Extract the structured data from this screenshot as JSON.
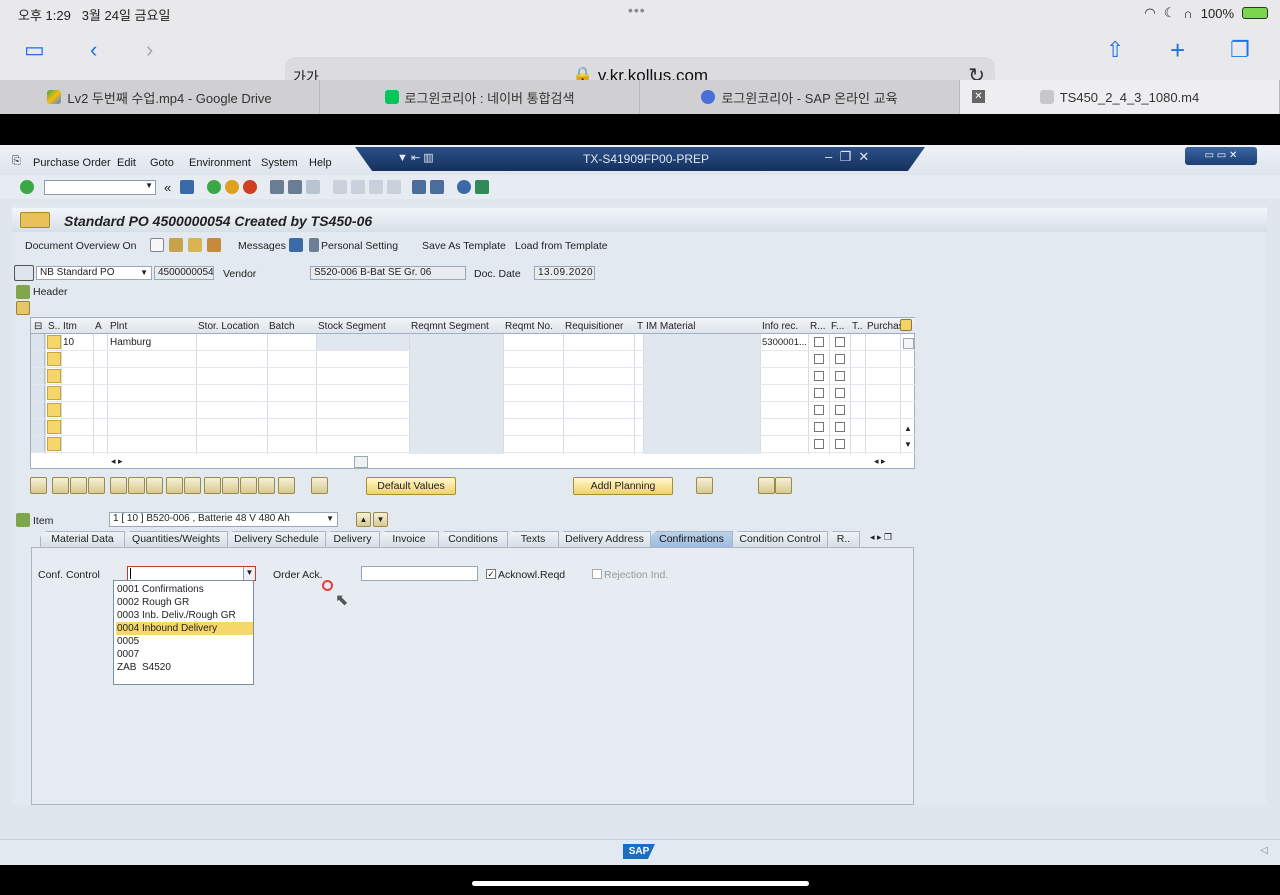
{
  "ios_status": {
    "time": "오후 1:29",
    "date": "3월 24일 금요일",
    "battery": "100%"
  },
  "browser": {
    "address_prefix": "가가",
    "url": "v.kr.kollus.com",
    "tabs": [
      {
        "label": "Lv2 두번째 수업.mp4 - Google Drive",
        "icon": "google-drive-icon"
      },
      {
        "label": "로그윈코리아 : 네이버 통합검색",
        "icon": "naver-icon"
      },
      {
        "label": "로그윈코리아 - SAP 온라인 교육",
        "icon": "play-icon"
      },
      {
        "label": "TS450_2_4_3_1080.m4",
        "icon": "kollus-icon"
      }
    ]
  },
  "sap": {
    "menu": [
      "Purchase Order",
      "Edit",
      "Goto",
      "Environment",
      "System",
      "Help"
    ],
    "window_title": "TX-S41909FP00-PREP",
    "doc_title": "Standard PO 4500000054 Created by TS450-06",
    "app_toolbar": {
      "doc_overview": "Document Overview On",
      "messages": "Messages",
      "personal_setting": "Personal Setting",
      "save_template": "Save As Template",
      "load_template": "Load from Template"
    },
    "header": {
      "doc_type": "NB Standard PO",
      "po_number": "4500000054",
      "vendor_label": "Vendor",
      "vendor_value": "S520-006 B-Bat SE Gr. 06",
      "doc_date_label": "Doc. Date",
      "doc_date_value": "13.09.2020",
      "header_label": "Header"
    },
    "grid": {
      "columns": [
        "S..",
        "Itm",
        "A",
        "Plnt",
        "Stor. Location",
        "Batch",
        "Stock Segment",
        "Reqmnt Segment",
        "Reqmt No.",
        "Requisitioner",
        "T",
        "IM Material",
        "Info rec.",
        "R...",
        "F...",
        "T..",
        "Purchas"
      ],
      "row1": {
        "itm": "10",
        "plnt": "Hamburg",
        "info_rec": "5300001..."
      }
    },
    "buttons": {
      "default_values": "Default Values",
      "addl_planning": "Addl Planning"
    },
    "item": {
      "label": "Item",
      "value": "1 [ 10 ] B520-006 , Batterie 48 V 480 Ah"
    },
    "tabs": [
      "Material Data",
      "Quantities/Weights",
      "Delivery Schedule",
      "Delivery",
      "Invoice",
      "Conditions",
      "Texts",
      "Delivery Address",
      "Confirmations",
      "Condition Control",
      "R.."
    ],
    "confirmations": {
      "conf_control_label": "Conf. Control",
      "order_ack_label": "Order Ack.",
      "acknowl_reqd": "Acknowl.Reqd",
      "rejection_ind": "Rejection Ind."
    },
    "dropdown_options": [
      {
        "code": "0001",
        "text": "Confirmations"
      },
      {
        "code": "0002",
        "text": "Rough GR"
      },
      {
        "code": "0003",
        "text": "Inb. Deliv./Rough GR"
      },
      {
        "code": "0004",
        "text": "Inbound Delivery"
      },
      {
        "code": "0005",
        "text": ""
      },
      {
        "code": "0007",
        "text": ""
      },
      {
        "code": "ZAB",
        "text": "S4520"
      }
    ],
    "footer_logo": "SAP"
  }
}
